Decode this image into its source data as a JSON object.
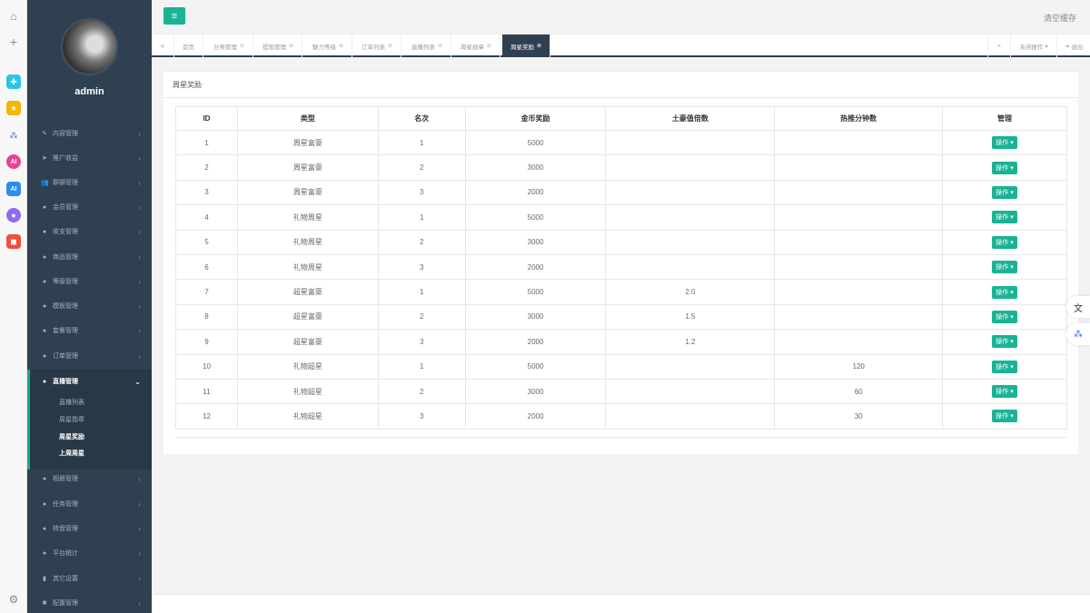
{
  "rail": {
    "icons": [
      "home-icon",
      "plus-icon",
      "app-cyan-icon",
      "star-icon",
      "network-icon",
      "ai-ring-icon",
      "ai-square-icon",
      "chat-bubble-icon",
      "gamepad-icon",
      "settings-icon"
    ]
  },
  "sidebar": {
    "username": "admin",
    "items": [
      {
        "label": "内容管理",
        "icon": "edit-icon"
      },
      {
        "label": "推广收益",
        "icon": "send-icon"
      },
      {
        "label": "群聊管理",
        "icon": "group-icon"
      },
      {
        "label": "会员管理",
        "icon": "user-icon"
      },
      {
        "label": "收支管理",
        "icon": "user-icon"
      },
      {
        "label": "商品管理",
        "icon": "user-icon"
      },
      {
        "label": "等级管理",
        "icon": "user-icon"
      },
      {
        "label": "模板管理",
        "icon": "user-icon"
      },
      {
        "label": "套餐管理",
        "icon": "user-icon"
      },
      {
        "label": "订单管理",
        "icon": "user-icon"
      },
      {
        "label": "直播管理",
        "icon": "user-icon"
      },
      {
        "label": "相册管理",
        "icon": "user-icon"
      },
      {
        "label": "任务管理",
        "icon": "user-icon"
      },
      {
        "label": "转盘管理",
        "icon": "user-icon"
      },
      {
        "label": "平台统计",
        "icon": "user-icon"
      },
      {
        "label": "其它设置",
        "icon": "book-icon"
      },
      {
        "label": "配置管理",
        "icon": "gear-icon"
      }
    ],
    "sub_items": [
      {
        "label": "直播列表"
      },
      {
        "label": "周星勋章"
      },
      {
        "label": "周星奖励"
      },
      {
        "label": "上周周星"
      }
    ]
  },
  "topbar": {
    "clear_cache": "清空缓存"
  },
  "tabs": {
    "items": [
      {
        "label": "首页",
        "closable": false
      },
      {
        "label": "分类管理",
        "closable": true
      },
      {
        "label": "提现管理",
        "closable": true
      },
      {
        "label": "魅力等级",
        "closable": true
      },
      {
        "label": "订单列表",
        "closable": true
      },
      {
        "label": "直播列表",
        "closable": true
      },
      {
        "label": "周星勋章",
        "closable": true
      },
      {
        "label": "周星奖励",
        "closable": true
      }
    ],
    "close_actions": "关闭操作",
    "logout": "退出"
  },
  "panel": {
    "title": "周星奖励"
  },
  "table": {
    "headers": [
      "ID",
      "类型",
      "名次",
      "金币奖励",
      "土豪值倍数",
      "热推分钟数",
      "管理"
    ],
    "action_label": "操作",
    "rows": [
      [
        "1",
        "周星富豪",
        "1",
        "5000",
        "",
        ""
      ],
      [
        "2",
        "周星富豪",
        "2",
        "3000",
        "",
        ""
      ],
      [
        "3",
        "周星富豪",
        "3",
        "2000",
        "",
        ""
      ],
      [
        "4",
        "礼物周星",
        "1",
        "5000",
        "",
        ""
      ],
      [
        "5",
        "礼物周星",
        "2",
        "3000",
        "",
        ""
      ],
      [
        "6",
        "礼物周星",
        "3",
        "2000",
        "",
        ""
      ],
      [
        "7",
        "超星富豪",
        "1",
        "5000",
        "2.0",
        ""
      ],
      [
        "8",
        "超星富豪",
        "2",
        "3000",
        "1.5",
        ""
      ],
      [
        "9",
        "超星富豪",
        "3",
        "2000",
        "1.2",
        ""
      ],
      [
        "10",
        "礼物超星",
        "1",
        "5000",
        "",
        "120"
      ],
      [
        "11",
        "礼物超星",
        "2",
        "3000",
        "",
        "60"
      ],
      [
        "12",
        "礼物超星",
        "3",
        "2000",
        "",
        "30"
      ]
    ]
  },
  "colors": {
    "sidebar": "#2f4050",
    "accent": "#1ab394"
  }
}
